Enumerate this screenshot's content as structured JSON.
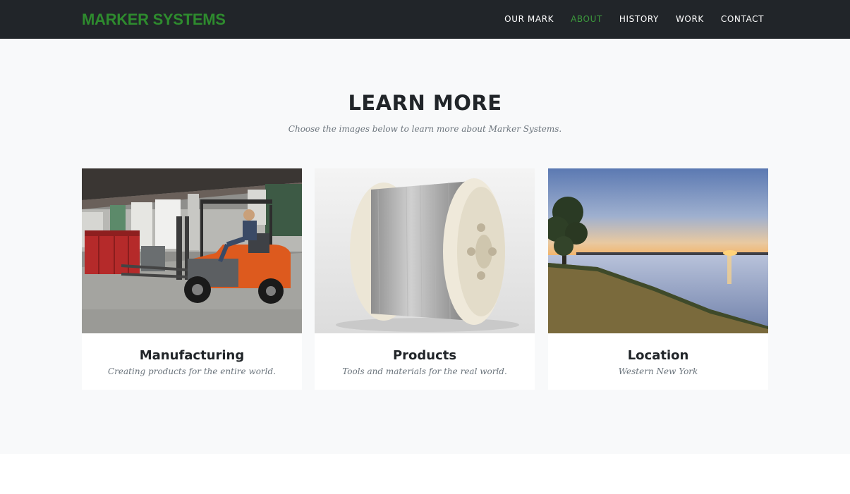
{
  "brand": {
    "name": "MARKER SYSTEMS",
    "color": "#2e8b2e"
  },
  "nav": {
    "items": [
      {
        "label": "OUR MARK",
        "active": false
      },
      {
        "label": "ABOUT",
        "active": true
      },
      {
        "label": "HISTORY",
        "active": false
      },
      {
        "label": "WORK",
        "active": false
      },
      {
        "label": "CONTACT",
        "active": false
      }
    ],
    "active_color": "#3c9a3c"
  },
  "section": {
    "heading": "LEARN MORE",
    "subheading": "Choose the images below to learn more about Marker Systems."
  },
  "cards": [
    {
      "title": "Manufacturing",
      "text": "Creating products for the entire world.",
      "image": "forklift-warehouse-photo"
    },
    {
      "title": "Products",
      "text": "Tools and materials for the real world.",
      "image": "wire-spool-photo"
    },
    {
      "title": "Location",
      "text": "Western New York",
      "image": "lake-sunset-photo"
    }
  ]
}
